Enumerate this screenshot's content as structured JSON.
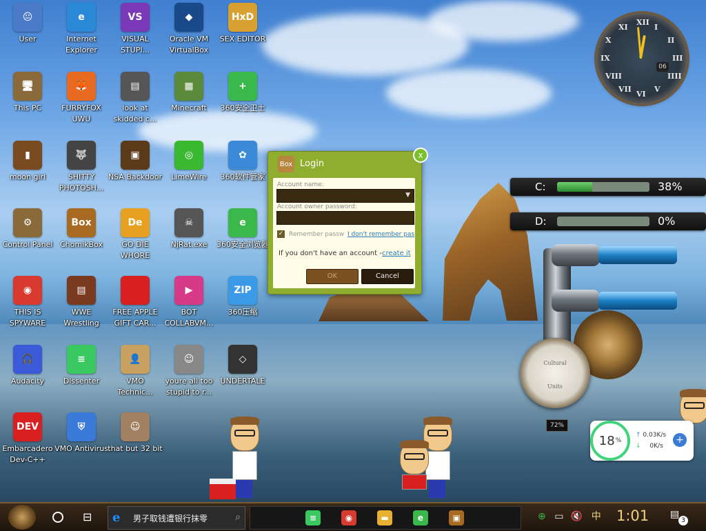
{
  "desktop": {
    "icons": [
      {
        "label": "User",
        "glyph": "😐",
        "color": "#4a7ac8"
      },
      {
        "label": "Internet Explorer",
        "glyph": "e",
        "color": "#2a8ad8"
      },
      {
        "label": "VISUAL STUPI...",
        "glyph": "VS",
        "color": "#7a3ab8"
      },
      {
        "label": "Oracle VM VirtualBox",
        "glyph": "◆",
        "color": "#1a4a8a"
      },
      {
        "label": "SEX EDITOR",
        "glyph": "HxD",
        "color": "#d8a030"
      },
      {
        "label": "This PC",
        "glyph": "🖥",
        "color": "#8a6a3a"
      },
      {
        "label": "FURRYFOX UWU",
        "glyph": "🦊",
        "color": "#e86a20"
      },
      {
        "label": "look at skidded c...",
        "glyph": "▤",
        "color": "#555"
      },
      {
        "label": "Minecraft",
        "glyph": "▦",
        "color": "#5a8a3a"
      },
      {
        "label": "360安全卫士",
        "glyph": "+",
        "color": "#3ab84a"
      },
      {
        "label": "moon girl",
        "glyph": "▮",
        "color": "#7a4a20"
      },
      {
        "label": "SHITTY PHOTOSH...",
        "glyph": "🐺",
        "color": "#444"
      },
      {
        "label": "NSA Backdoor",
        "glyph": "▣",
        "color": "#5a3a18"
      },
      {
        "label": "LimeWire",
        "glyph": "◎",
        "color": "#3ab830"
      },
      {
        "label": "360软件管家",
        "glyph": "✿",
        "color": "#3a8ad8"
      },
      {
        "label": "Control Panel",
        "glyph": "⚙",
        "color": "#8a6a3a"
      },
      {
        "label": "ChomikBox",
        "glyph": "Box",
        "color": "#a86a20"
      },
      {
        "label": "GO DIE WHORE",
        "glyph": "De",
        "color": "#e8a020"
      },
      {
        "label": "NjRat.exe",
        "glyph": "☠",
        "color": "#555"
      },
      {
        "label": "360安全浏览器",
        "glyph": "e",
        "color": "#3ab84a"
      },
      {
        "label": "THIS IS SPYWARE",
        "glyph": "◉",
        "color": "#d83a30"
      },
      {
        "label": "WWE Wrestling",
        "glyph": "▤",
        "color": "#7a3a20"
      },
      {
        "label": "FREE APPLE GIFT CAR...",
        "glyph": "",
        "color": "#d82020"
      },
      {
        "label": "BOT COLLABVM...",
        "glyph": "▶",
        "color": "#d83a8a"
      },
      {
        "label": "360压缩",
        "glyph": "ZIP",
        "color": "#3a9ae8"
      },
      {
        "label": "Audacity",
        "glyph": "🎧",
        "color": "#3a5ad8"
      },
      {
        "label": "Dissenter",
        "glyph": "≡",
        "color": "#3ac860"
      },
      {
        "label": "VMO Technic...",
        "glyph": "👤",
        "color": "#c8a060"
      },
      {
        "label": "youre all too stupid to r...",
        "glyph": "☺",
        "color": "#888"
      },
      {
        "label": "UNDERTALE",
        "glyph": "◇",
        "color": "#333"
      },
      {
        "label": "Embarcadero Dev-C++",
        "glyph": "DEV",
        "color": "#d82020"
      },
      {
        "label": "VMO Antivirus",
        "glyph": "⛨",
        "color": "#3a7ad8"
      },
      {
        "label": "that but 32 bit",
        "glyph": "☺",
        "color": "#a08060"
      }
    ]
  },
  "clock": {
    "numerals": [
      "XII",
      "I",
      "II",
      "III",
      "IIII",
      "V",
      "VI",
      "VII",
      "VIII",
      "IX",
      "X",
      "XI"
    ],
    "day": "06"
  },
  "login": {
    "title": "Login",
    "close": "x",
    "account_name_label": "Account name:",
    "account_name_value": "",
    "password_label": "Account owner password:",
    "remember_label": "Remember passw",
    "forgot_link": "I don't remember pas",
    "no_account_text": "If you don't have an account -",
    "create_link": "create it",
    "ok_label": "OK",
    "cancel_label": "Cancel",
    "app_glyph": "Box"
  },
  "drives": [
    {
      "label": "C:",
      "percent_text": "38%",
      "fill": 0.38
    },
    {
      "label": "D:",
      "percent_text": "0%",
      "fill": 0.0
    }
  ],
  "gauge": {
    "brand": "Cultural",
    "unit": "Units",
    "counter": "72%"
  },
  "network": {
    "usage": "18",
    "unit": "%",
    "up": "0.03K/s",
    "down": "0K/s",
    "up_arrow": "↑",
    "down_arrow": "↓",
    "plus": "+"
  },
  "taskbar": {
    "search_text": "男子取钱遭银行抹零",
    "search_glyph": "e",
    "search_icon": "⌕",
    "taskview_glyph": "⊟",
    "apps": [
      {
        "name": "dissenter",
        "glyph": "≡",
        "color": "#3ac860"
      },
      {
        "name": "chrome",
        "glyph": "◉",
        "color": "#d83a30"
      },
      {
        "name": "explorer",
        "glyph": "▬",
        "color": "#e8b030"
      },
      {
        "name": "360-browser",
        "glyph": "e",
        "color": "#3ab84a"
      },
      {
        "name": "chomikbox",
        "glyph": "▣",
        "color": "#a86a20"
      }
    ],
    "tray_text": "中",
    "time": "1:01",
    "notification_count": "3"
  }
}
